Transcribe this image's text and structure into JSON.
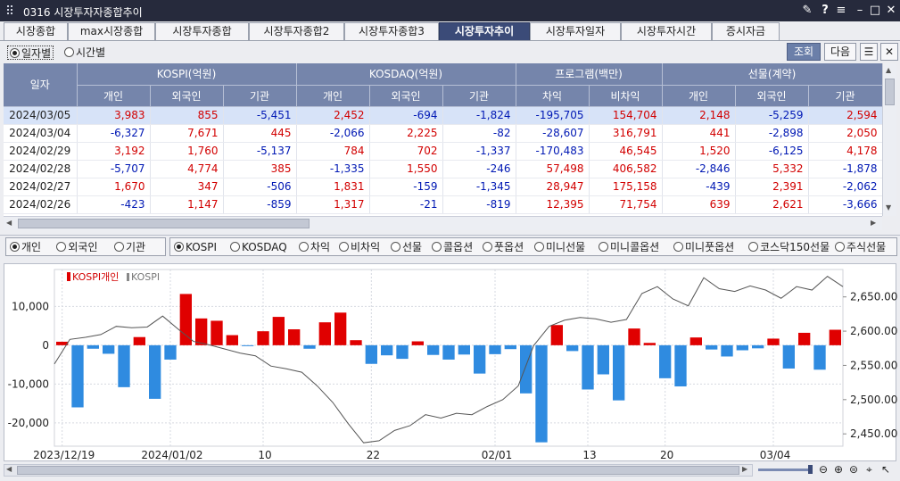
{
  "window": {
    "title": "0316 시장투자자종합추이"
  },
  "tabs": [
    {
      "label": "시장종합"
    },
    {
      "label": "max시장종합"
    },
    {
      "label": "시장투자종합"
    },
    {
      "label": "시장투자종합2"
    },
    {
      "label": "시장투자종합3"
    },
    {
      "label": "시장투자추이",
      "active": true
    },
    {
      "label": "시장투자일자"
    },
    {
      "label": "시장투자시간"
    },
    {
      "label": "증시자금"
    }
  ],
  "mode": {
    "daily": "일자별",
    "time": "시간별",
    "selected": "일자별"
  },
  "buttons": {
    "query": "조회",
    "next": "다음"
  },
  "table": {
    "date_header": "일자",
    "groups": [
      "KOSPI(억원)",
      "KOSDAQ(억원)",
      "프로그램(백만)",
      "선물(계약)"
    ],
    "sub_headers": [
      "개인",
      "외국인",
      "기관",
      "개인",
      "외국인",
      "기관",
      "차익",
      "비차익",
      "개인",
      "외국인",
      "기관"
    ],
    "rows": [
      {
        "date": "2024/03/05",
        "cells": [
          "3,983",
          "855",
          "-5,451",
          "2,452",
          "-694",
          "-1,824",
          "-195,705",
          "154,704",
          "2,148",
          "-5,259",
          "2,594"
        ]
      },
      {
        "date": "2024/03/04",
        "cells": [
          "-6,327",
          "7,671",
          "445",
          "-2,066",
          "2,225",
          "-82",
          "-28,607",
          "316,791",
          "441",
          "-2,898",
          "2,050"
        ]
      },
      {
        "date": "2024/02/29",
        "cells": [
          "3,192",
          "1,760",
          "-5,137",
          "784",
          "702",
          "-1,337",
          "-170,483",
          "46,545",
          "1,520",
          "-6,125",
          "4,178"
        ]
      },
      {
        "date": "2024/02/28",
        "cells": [
          "-5,707",
          "4,774",
          "385",
          "-1,335",
          "1,550",
          "-246",
          "57,498",
          "406,582",
          "-2,846",
          "5,332",
          "-1,878"
        ]
      },
      {
        "date": "2024/02/27",
        "cells": [
          "1,670",
          "347",
          "-506",
          "1,831",
          "-159",
          "-1,345",
          "28,947",
          "175,158",
          "-439",
          "2,391",
          "-2,062"
        ]
      },
      {
        "date": "2024/02/26",
        "cells": [
          "-423",
          "1,147",
          "-859",
          "1,317",
          "-21",
          "-819",
          "12,395",
          "71,754",
          "639",
          "2,621",
          "-3,666"
        ]
      }
    ]
  },
  "investor_select": {
    "options": [
      "개인",
      "외국인",
      "기관"
    ],
    "selected": "개인"
  },
  "market_select": {
    "options": [
      "KOSPI",
      "KOSDAQ",
      "차익",
      "비차익",
      "선물",
      "콜옵션",
      "풋옵션",
      "미니선물",
      "미니콜옵션",
      "미니풋옵션",
      "코스닥150선물",
      "주식선물"
    ],
    "selected": "KOSPI"
  },
  "colors": {
    "positive": "#e00000",
    "negative": "#2f8be0",
    "index_line": "#555555",
    "header": "#7585ab"
  },
  "chart_data": {
    "type": "bar",
    "legend": [
      "KOSPI개인",
      "KOSPI"
    ],
    "x_ticks": [
      "2023/12/19",
      "2024/01/02",
      "10",
      "22",
      "02/01",
      "13",
      "20",
      "03/04"
    ],
    "tick_index": [
      0,
      7,
      13,
      20,
      28,
      34,
      39,
      46
    ],
    "left_axis": {
      "ticks": [
        "10,000",
        "0",
        "-10,000",
        "-20,000"
      ],
      "values": [
        10000,
        0,
        -10000,
        -20000
      ],
      "ylim": [
        -26000,
        19500
      ]
    },
    "right_axis": {
      "ticks": [
        "2,650.00",
        "2,600.00",
        "2,550.00",
        "2,500.00",
        "2,450.00"
      ],
      "values": [
        2650,
        2600,
        2550,
        2500,
        2450
      ],
      "ylim": [
        2432,
        2690
      ]
    },
    "series": [
      {
        "name": "KOSPI개인",
        "type": "bar",
        "values": [
          900,
          -16000,
          -900,
          -2200,
          -10800,
          2100,
          -13800,
          -3700,
          13200,
          6900,
          6300,
          2600,
          -200,
          3600,
          7300,
          4100,
          -900,
          5900,
          8400,
          1300,
          -4800,
          -2600,
          -3500,
          1000,
          -2500,
          -3700,
          -2400,
          -7300,
          -2300,
          -1000,
          -12400,
          -25000,
          5200,
          -1500,
          -11400,
          -7500,
          -14200,
          4300,
          600,
          -8500,
          -10600,
          2000,
          -1100,
          -2900,
          -1300,
          -800,
          1700,
          -6000,
          3200,
          -6300,
          3983
        ]
      },
      {
        "name": "KOSPI",
        "type": "line",
        "values": [
          2552,
          2588,
          2591,
          2595,
          2607,
          2605,
          2606,
          2622,
          2603,
          2585,
          2580,
          2574,
          2568,
          2564,
          2549,
          2545,
          2540,
          2520,
          2496,
          2465,
          2437,
          2440,
          2455,
          2462,
          2478,
          2473,
          2480,
          2478,
          2490,
          2500,
          2520,
          2579,
          2607,
          2616,
          2620,
          2618,
          2613,
          2617,
          2655,
          2665,
          2647,
          2637,
          2678,
          2662,
          2658,
          2666,
          2660,
          2648,
          2665,
          2660,
          2680,
          2665
        ]
      }
    ]
  }
}
